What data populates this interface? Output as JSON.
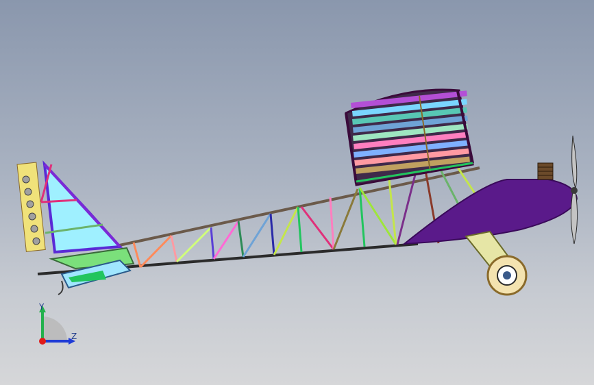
{
  "viewport": {
    "background_top": "#8a97ad",
    "background_bottom": "#d6d7d9"
  },
  "triad": {
    "y_label": "Y",
    "z_label": "Z",
    "y_axis_color": "#22b14c",
    "z_axis_color": "#1f3bd6",
    "origin_color": "#e01b1b"
  },
  "model": {
    "frame_colors": [
      "#ff6a6a",
      "#ff69b4",
      "#7b3fc4",
      "#3f7fff",
      "#22c55e",
      "#c4e64a",
      "#f06f9a",
      "#8a2be2",
      "#2aa198",
      "#ff9f1a"
    ],
    "wing_rib_colors": [
      "#b34fd6",
      "#7ad6ff",
      "#58c7b4",
      "#6fa3d6",
      "#9ee6c1",
      "#ff7fbf",
      "#7fb0ff",
      "#c77dff",
      "#ffd1a1",
      "#a3e4a3",
      "#ff9aa2",
      "#c0a060"
    ],
    "cowl_color": "#5a1a8a",
    "tail_fill": "#9ff0ff",
    "wheel_color": "#f4e3b0",
    "gear_color": "#e6e6a6"
  }
}
